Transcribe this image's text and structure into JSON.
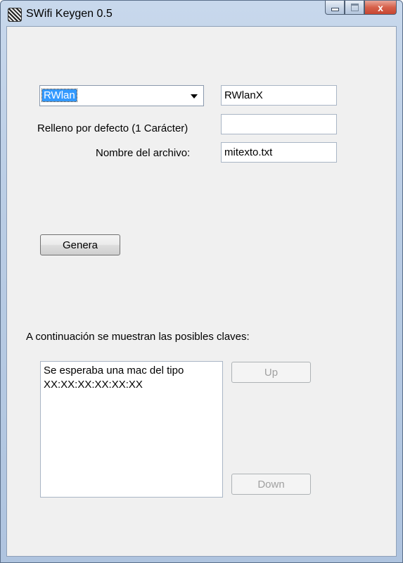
{
  "window": {
    "title": "SWifi Keygen 0.5",
    "icon": "app-icon",
    "caption_buttons": {
      "minimize_icon": "minimize-icon",
      "maximize_icon": "maximize-icon",
      "close_glyph": "x"
    }
  },
  "form": {
    "type_combo": {
      "selected": "RWlan"
    },
    "prefix_value": "RWlanX",
    "padding_label": "Relleno por defecto (1 Carácter)",
    "padding_value": "",
    "filename_label": "Nombre del archivo:",
    "filename_value": "mitexto.txt",
    "generate_label": "Genera"
  },
  "results": {
    "heading": "A continuación se muestran las posibles claves:",
    "lines": [
      "Se esperaba una mac del tipo",
      "XX:XX:XX:XX:XX:XX"
    ],
    "up_label": "Up",
    "down_label": "Down"
  },
  "colors": {
    "selection": "#3399ff",
    "client_bg": "#f0f0f0",
    "close_button": "#c74632"
  }
}
